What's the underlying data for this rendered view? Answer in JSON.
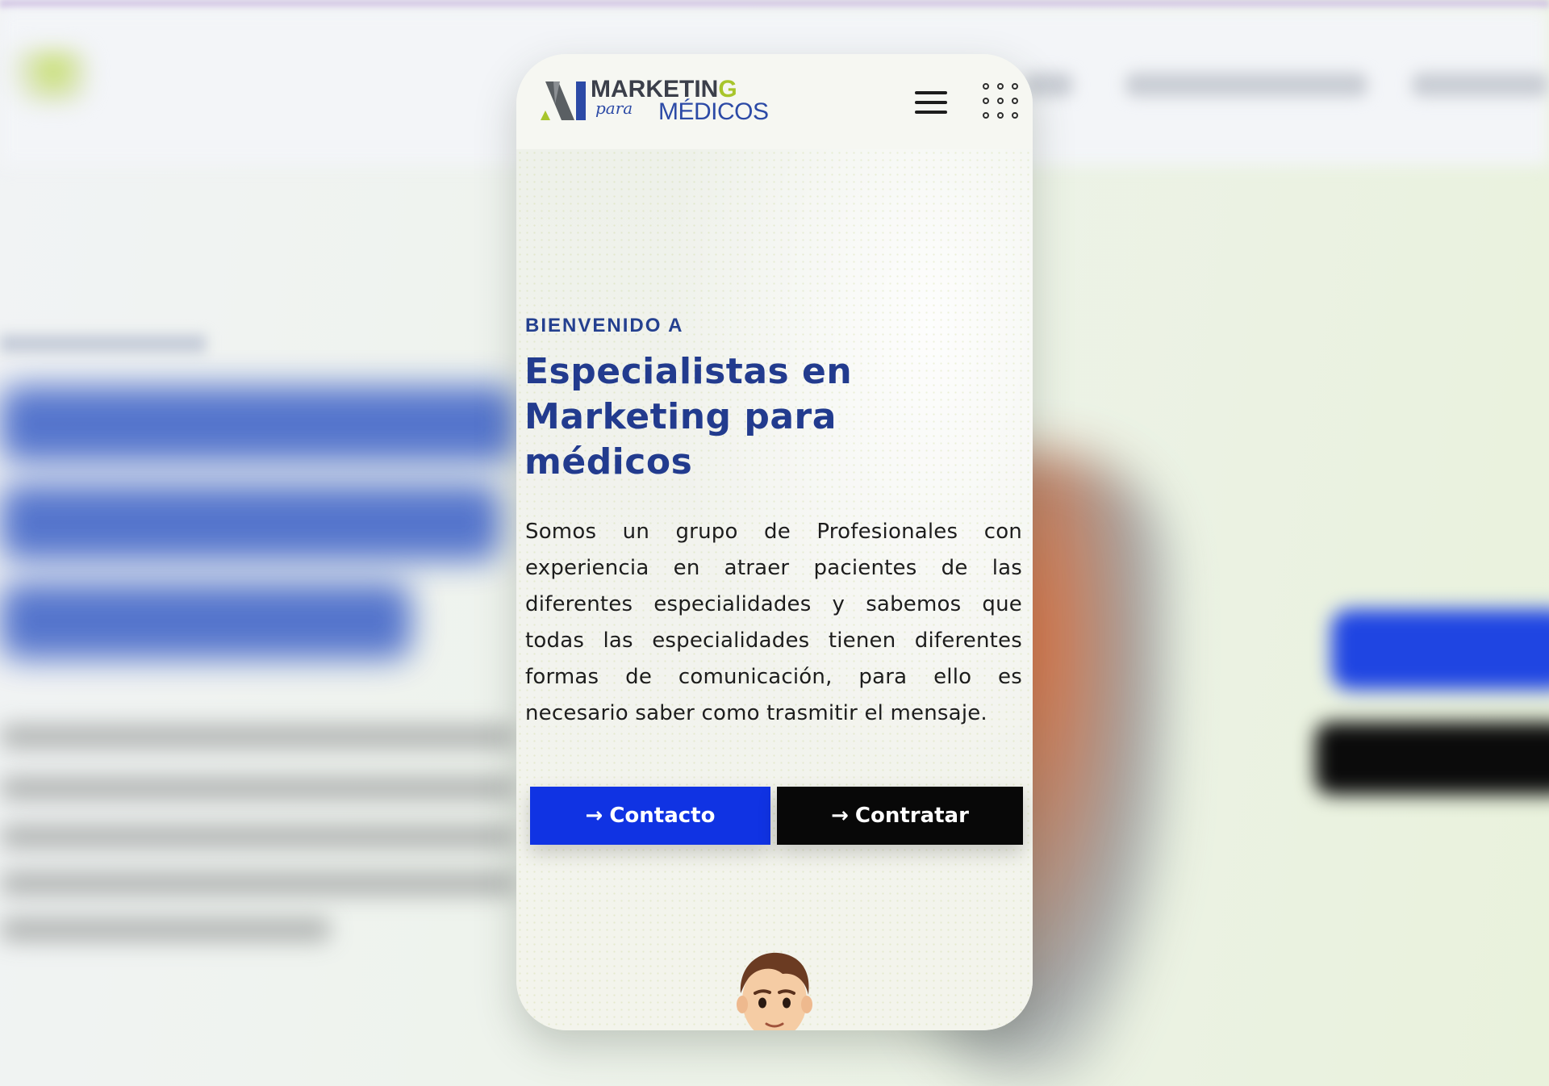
{
  "site": {
    "logo": {
      "word_marketing": "MARKETIN",
      "word_marketing_accent": "G",
      "word_para": "para",
      "word_medicos": "MÉDICOS"
    }
  },
  "header": {
    "menu_icon": "hamburger-menu-icon",
    "apps_icon": "grid-dots-icon"
  },
  "hero": {
    "eyebrow": "BIENVENIDO A",
    "title": "Especialistas en Marketing para médicos",
    "description": "Somos un grupo de Profesionales con experiencia en atraer pacientes de las diferentes especialidades y sabemos que todas las especialidades tienen diferentes formas de comunicación, para ello es necesario saber  como trasmitir el mensaje.",
    "buttons": {
      "contact_arrow": "→",
      "contact_label": "Contacto",
      "hire_arrow": "→",
      "hire_label": "Contratar"
    }
  },
  "colors": {
    "brand_blue": "#223b8e",
    "button_blue": "#1033e3",
    "button_black": "#080808",
    "logo_green": "#a8c52c"
  }
}
